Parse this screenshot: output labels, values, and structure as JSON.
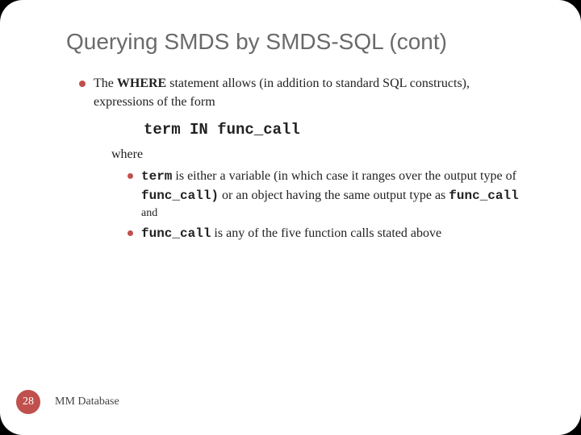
{
  "title": "Querying SMDS by SMDS-SQL (cont)",
  "main": {
    "intro_pre": "The ",
    "intro_bold": "WHERE",
    "intro_post": " statement allows (in addition to standard SQL constructs), expressions of the form",
    "code": "term IN func_call",
    "where": "where",
    "sub1_term": "term",
    "sub1_mid": " is either a variable (in which case it ranges over the output type of ",
    "sub1_func1": "func_call)",
    "sub1_mid2": " or an object having the same output type as ",
    "sub1_func2": "func_call",
    "and": "and",
    "sub2_func": "func_call",
    "sub2_rest": " is any of the five function calls stated above"
  },
  "footer": {
    "page": "28",
    "label": "MM Database"
  }
}
